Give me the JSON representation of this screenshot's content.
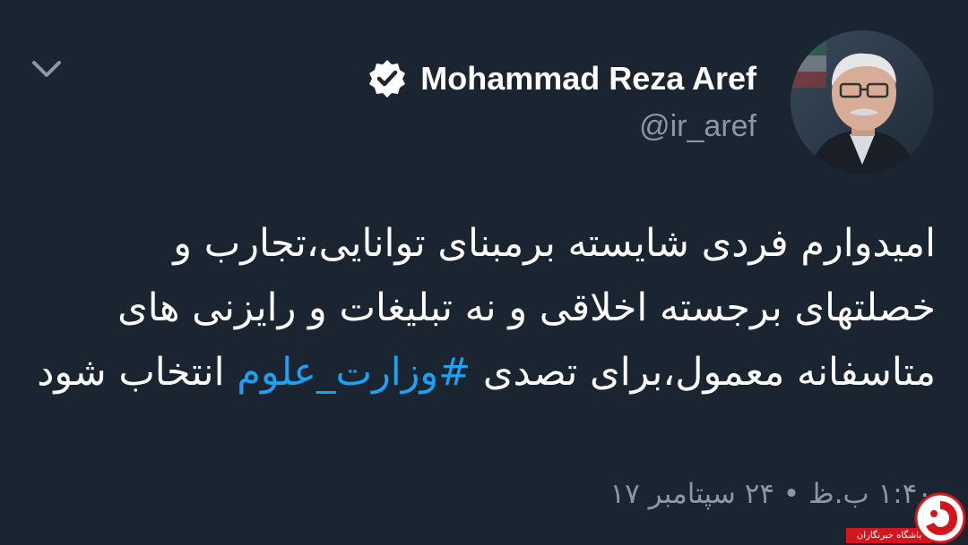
{
  "header": {
    "back_icon": "chevron-down-icon",
    "verified_icon": "verified-badge-icon"
  },
  "author": {
    "display_name": "Mohammad Reza Aref",
    "handle": "@ir_aref"
  },
  "tweet": {
    "text_before_hashtag": "امیدوارم فردی شایسته برمبنای توانایی،تجارب و خصلتهای برجسته اخلاقی و نه تبلیغات و رایزنی های متاسفانه معمول،برای تصدی ",
    "hashtag": "#وزارت_علوم",
    "text_after_hashtag": " انتخاب شود",
    "timestamp": "۱:۴۰ ب.ظ • ۲۴ سپتامبر ۱۷"
  },
  "watermark": {
    "label": "باشگاه خبرنگاران",
    "logo_icon": "ypc-logo-icon"
  },
  "colors": {
    "background": "#1b2431",
    "text_primary": "#ffffff",
    "text_secondary": "#8899a6",
    "hashtag": "#1da1f2",
    "watermark_red": "#d4151c"
  }
}
